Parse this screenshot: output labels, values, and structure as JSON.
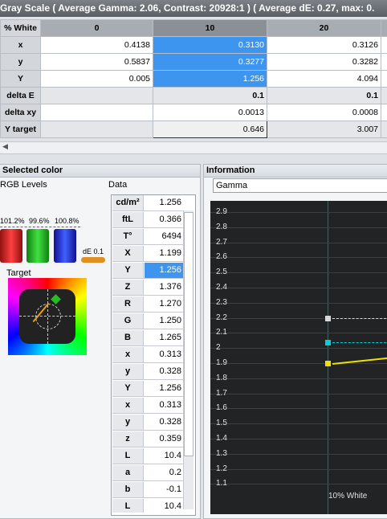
{
  "title": "Gray Scale ( Average Gamma: 2.06, Contrast: 20928:1 ) ( Average dE: 0.27, max: 0.",
  "grid": {
    "row_header": "% White",
    "columns": [
      "0",
      "10",
      "20"
    ],
    "rows": [
      {
        "label": "x",
        "values": [
          "0.4138",
          "0.3130",
          "0.3126"
        ]
      },
      {
        "label": "y",
        "values": [
          "0.5837",
          "0.3277",
          "0.3282"
        ]
      },
      {
        "label": "Y",
        "values": [
          "0.005",
          "1.256",
          "4.094"
        ]
      },
      {
        "label": "delta E",
        "values": [
          "",
          "0.1",
          "0.1"
        ]
      },
      {
        "label": "delta xy",
        "values": [
          "",
          "0.0013",
          "0.0008"
        ]
      },
      {
        "label": "Y target",
        "values": [
          "",
          "0.646",
          "3.007"
        ]
      }
    ]
  },
  "selected_color": {
    "title": "Selected color",
    "rgb_label": "RGB Levels",
    "data_label": "Data",
    "bars": [
      {
        "label": "101.2%",
        "color": "#e02020",
        "level": 1.012
      },
      {
        "label": "99.6%",
        "color": "#20c030",
        "level": 0.996
      },
      {
        "label": "100.8%",
        "color": "#2040e0",
        "level": 1.008
      }
    ],
    "de_label": "dE 0.1",
    "target_label": "Target",
    "data": [
      {
        "label": "cd/m²",
        "value": "1.256"
      },
      {
        "label": "ftL",
        "value": "0.366"
      },
      {
        "label": "T°",
        "value": "6494"
      },
      {
        "label": "X",
        "value": "1.199"
      },
      {
        "label": "Y",
        "value": "1.256",
        "selected": true
      },
      {
        "label": "Z",
        "value": "1.376"
      },
      {
        "label": "R",
        "value": "1.270"
      },
      {
        "label": "G",
        "value": "1.250"
      },
      {
        "label": "B",
        "value": "1.265"
      },
      {
        "label": "x",
        "value": "0.313"
      },
      {
        "label": "y",
        "value": "0.328"
      },
      {
        "label": "Y",
        "value": "1.256"
      },
      {
        "label": "x",
        "value": "0.313"
      },
      {
        "label": "y",
        "value": "0.328"
      },
      {
        "label": "z",
        "value": "0.359"
      },
      {
        "label": "L",
        "value": "10.4"
      },
      {
        "label": "a",
        "value": "0.2"
      },
      {
        "label": "b",
        "value": "-0.1"
      },
      {
        "label": "L",
        "value": "10.4"
      }
    ]
  },
  "information": {
    "title": "Information",
    "selector": "Gamma",
    "chart": {
      "y_ticks": [
        "2.9",
        "2.8",
        "2.7",
        "2.6",
        "2.5",
        "2.4",
        "2.3",
        "2.2",
        "2.1",
        "2",
        "1.9",
        "1.8",
        "1.7",
        "1.6",
        "1.5",
        "1.4",
        "1.3",
        "1.2",
        "1.1"
      ],
      "x_label": "10% White",
      "markers": [
        {
          "value": 2.2,
          "color": "#d8d8d8"
        },
        {
          "value": 2.04,
          "color": "#00d0d8"
        },
        {
          "value": 1.9,
          "color": "#f0e000"
        }
      ]
    }
  }
}
